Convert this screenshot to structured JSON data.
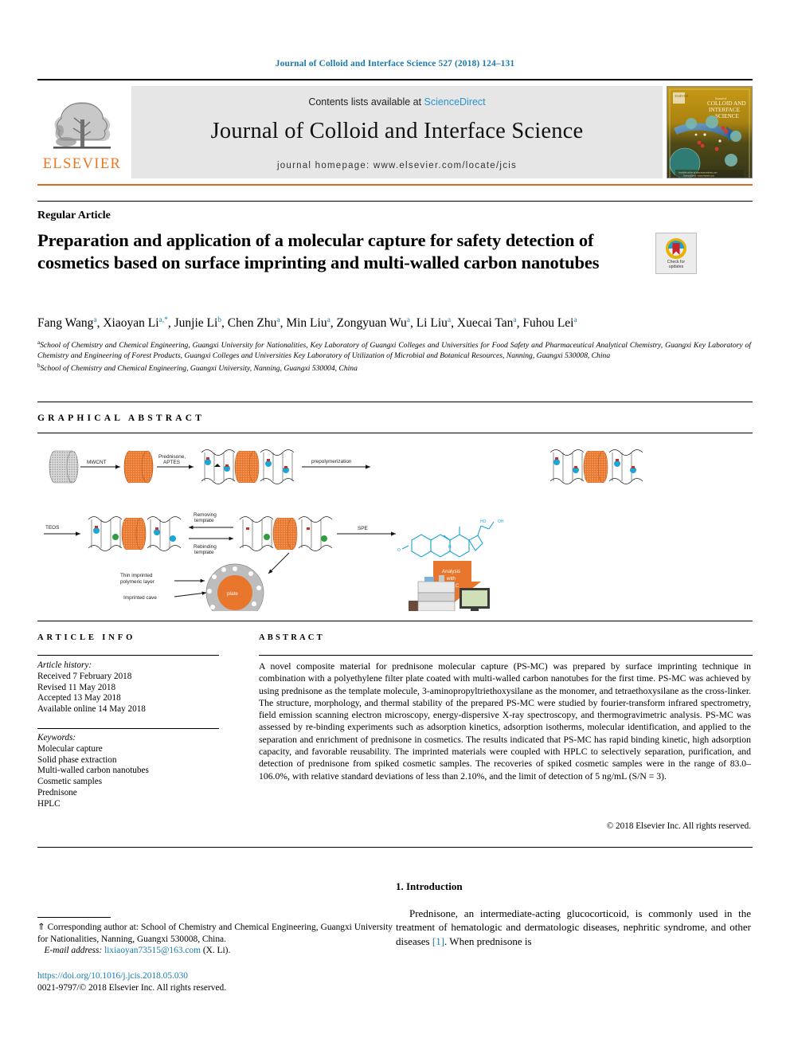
{
  "running_head": "Journal of Colloid and Interface Science 527 (2018) 124–131",
  "masthead": {
    "contents_prefix": "Contents lists available at ",
    "sciencedirect": "ScienceDirect",
    "journal_title": "Journal of Colloid and Interface Science",
    "homepage": "journal homepage: www.elsevier.com/locate/jcis",
    "publisher": "ELSEVIER",
    "cover_title_small": "Journal of",
    "cover_title": "COLLOID AND INTERFACE SCIENCE",
    "colors": {
      "link_blue": "#2b93d1",
      "elsevier_orange": "#E87722",
      "rule_orange": "#dd6b1f",
      "cover_gold": "#b08a13"
    }
  },
  "article": {
    "type_label": "Regular Article",
    "title": "Preparation and application of a molecular capture for safety detection of cosmetics based on surface imprinting and multi-walled carbon nanotubes",
    "crossmark_line1": "Check for",
    "crossmark_line2": "updates",
    "authors": [
      {
        "name": "Fang Wang",
        "sup": "a",
        "star": false
      },
      {
        "name": "Xiaoyan Li",
        "sup": "a",
        "star": true
      },
      {
        "name": "Junjie Li",
        "sup": "b",
        "star": false
      },
      {
        "name": "Chen Zhu",
        "sup": "a",
        "star": false
      },
      {
        "name": "Min Liu",
        "sup": "a",
        "star": false
      },
      {
        "name": "Zongyuan Wu",
        "sup": "a",
        "star": false
      },
      {
        "name": "Li Liu",
        "sup": "a",
        "star": false
      },
      {
        "name": "Xuecai Tan",
        "sup": "a",
        "star": false
      },
      {
        "name": "Fuhou Lei",
        "sup": "a",
        "star": false
      }
    ],
    "affiliation_a": "School of Chemistry and Chemical Engineering, Guangxi University for Nationalities, Key Laboratory of Guangxi Colleges and Universities for Food Safety and Pharmaceutical Analytical Chemistry, Guangxi Key Laboratory of Chemistry and Engineering of Forest Products, Guangxi Colleges and Universities Key Laboratory of Utilization of Microbial and Botanical Resources, Nanning, Guangxi 530008, China",
    "affiliation_b": "School of Chemistry and Chemical Engineering, Guangxi University, Nanning, Guangxi 530004, China",
    "affiliation_a_marker": "a",
    "affiliation_b_marker": "b"
  },
  "graphical_abstract": {
    "heading": "GRAPHICAL ABSTRACT",
    "labels": {
      "mwcnt": "MWCNT",
      "prednisone_aptes": "Prednisone, APTES",
      "prepolymerization": "prepolymerization",
      "teos": "TEOS",
      "removing_template": "Removing template",
      "rebinding_template": "Rebinding template",
      "spe": "SPE",
      "thin_layer": "Thin imprinted polymeric layer",
      "imprinted_cave": "Imprinted cave",
      "plate": "plate",
      "analysis_hplc_1": "Analysis",
      "analysis_hplc_2": "with",
      "analysis_hplc_3": "HPLC"
    },
    "colors": {
      "orange": "#E8762C",
      "cyan": "#1BA6D6",
      "red": "#D32B20",
      "green": "#2E9E3E",
      "gray": "#8a8a8a"
    }
  },
  "info": {
    "heading": "ARTICLE INFO",
    "history_label": "Article history:",
    "history": [
      "Received 7 February 2018",
      "Revised 11 May 2018",
      "Accepted 13 May 2018",
      "Available online 14 May 2018"
    ],
    "keywords_label": "Keywords:",
    "keywords": [
      "Molecular capture",
      "Solid phase extraction",
      "Multi-walled carbon nanotubes",
      "Cosmetic samples",
      "Prednisone",
      "HPLC"
    ]
  },
  "abstract": {
    "heading": "ABSTRACT",
    "text": "A novel composite material for prednisone molecular capture (PS-MC) was prepared by surface imprinting technique in combination with a polyethylene filter plate coated with multi-walled carbon nanotubes for the first time. PS-MC was achieved by using prednisone as the template molecule, 3-aminopropyltriethoxysilane as the monomer, and tetraethoxysilane as the cross-linker. The structure, morphology, and thermal stability of the prepared PS-MC were studied by fourier-transform infrared spectrometry, field emission scanning electron microscopy, energy-dispersive X-ray spectroscopy, and thermogravimetric analysis. PS-MC was assessed by re-binding experiments such as adsorption kinetics, adsorption isotherms, molecular identification, and applied to the separation and enrichment of prednisone in cosmetics. The results indicated that PS-MC has rapid binding kinetic, high adsorption capacity, and favorable reusability. The imprinted materials were coupled with HPLC to selectively separation, purification, and detection of prednisone from spiked cosmetic samples. The recoveries of spiked cosmetic samples were in the range of 83.0–106.0%, with relative standard deviations of less than 2.10%, and the limit of detection of 5 ng/mL (S/N = 3).",
    "copyright": "© 2018 Elsevier Inc. All rights reserved."
  },
  "introduction": {
    "heading": "1. Introduction",
    "paragraph_part1": "Prednisone, an intermediate-acting glucocorticoid, is commonly used in the treatment of hematologic and dermatologic diseases, nephritic syndrome, and other diseases ",
    "reference": "[1]",
    "paragraph_part2": ". When prednisone is"
  },
  "footer": {
    "corresponding_marker": "⇑",
    "corresponding_text": "Corresponding author at: School of Chemistry and Chemical Engineering, Guangxi University for Nationalities, Nanning, Guangxi 530008, China.",
    "email_label": "E-mail address:",
    "email": "lixiaoyan73515@163.com",
    "email_owner": "(X. Li).",
    "doi": "https://doi.org/10.1016/j.jcis.2018.05.030",
    "issn_line": "0021-9797/© 2018 Elsevier Inc. All rights reserved."
  }
}
